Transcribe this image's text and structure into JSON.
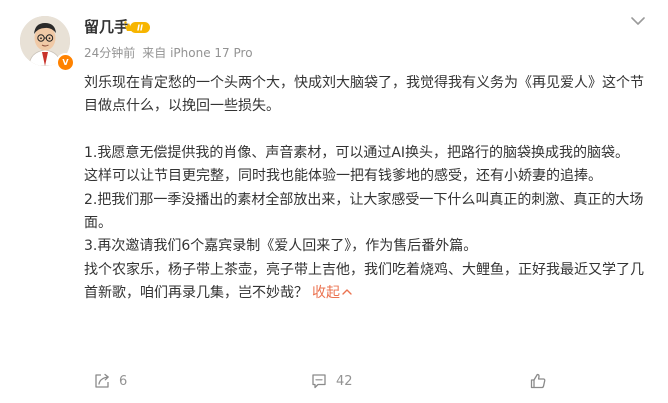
{
  "post": {
    "author": {
      "name": "留几手",
      "level_badge": "II",
      "verified_icon": "verified-v-icon"
    },
    "meta": {
      "time": "24分钟前",
      "source": "来自 iPhone 17 Pro"
    },
    "content": {
      "intro": "刘乐现在肯定愁的一个头两个大，快成刘大脑袋了，我觉得我有义务为《再见爱人》这个节目做点什么，以挽回一些损失。",
      "line1": "1.我愿意无偿提供我的肖像、声音素材，可以通过AI换头，把路行的脑袋换成我的脑袋。",
      "line2": "这样可以让节目更完整，同时我也能体验一把有钱爹地的感受，还有小娇妻的追捧。",
      "line3": "2.把我们那一季没播出的素材全部放出来，让大家感受一下什么叫真正的刺激、真正的大场面。",
      "line4": "3.再次邀请我们6个嘉宾录制《爱人回来了》，作为售后番外篇。",
      "line5": "找个农家乐，杨子带上茶壶，亮子带上吉他，我们吃着烧鸡、大鲤鱼，正好我最近又学了几首新歌，咱们再录几集，岂不妙哉？",
      "collapse_label": "收起"
    },
    "actions": {
      "repost_count": "6",
      "comment_count": "42"
    }
  }
}
